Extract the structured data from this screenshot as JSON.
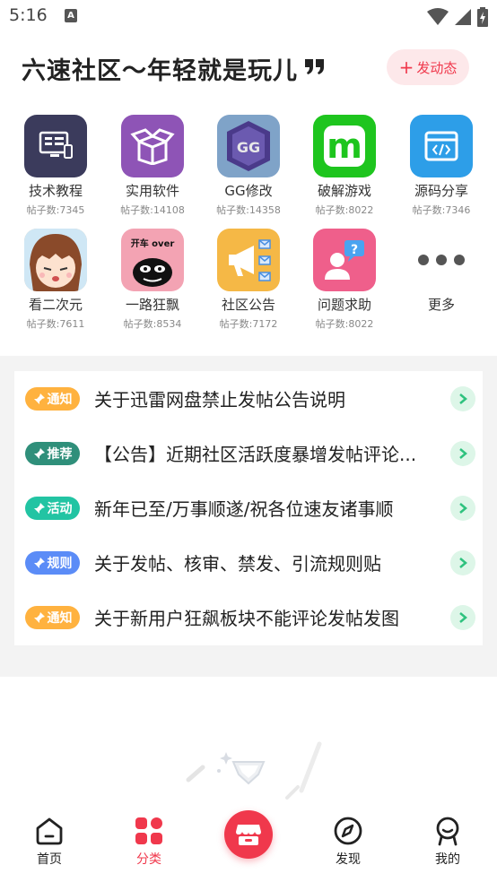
{
  "status_bar": {
    "time": "5:16",
    "notification_letter": "A"
  },
  "header": {
    "title": "六速社区～年轻就是玩儿",
    "post_button": "发动态"
  },
  "categories": [
    {
      "label": "技术教程",
      "count": "帖子数:7345"
    },
    {
      "label": "实用软件",
      "count": "帖子数:14108"
    },
    {
      "label": "GG修改",
      "count": "帖子数:14358",
      "icon_text": "GG"
    },
    {
      "label": "破解游戏",
      "count": "帖子数:8022",
      "icon_text": "m"
    },
    {
      "label": "源码分享",
      "count": "帖子数:7346"
    },
    {
      "label": "看二次元",
      "count": "帖子数:7611"
    },
    {
      "label": "一路狂飘",
      "count": "帖子数:8534",
      "icon_text": "开车 over"
    },
    {
      "label": "社区公告",
      "count": "帖子数:7172"
    },
    {
      "label": "问题求助",
      "count": "帖子数:8022",
      "icon_text": "?"
    },
    {
      "label": "更多"
    }
  ],
  "notices": [
    {
      "tag": "通知",
      "tag_color": "#ffb23f",
      "text": "关于迅雷网盘禁止发帖公告说明"
    },
    {
      "tag": "推荐",
      "tag_color": "#2f8f7a",
      "text": "【公告】近期社区活跃度暴增发帖评论..."
    },
    {
      "tag": "活动",
      "tag_color": "#22c4a3",
      "text": "新年已至/万事顺遂/祝各位速友诸事顺"
    },
    {
      "tag": "规则",
      "tag_color": "#5b8cf7",
      "text": "关于发帖、核审、禁发、引流规则贴"
    },
    {
      "tag": "通知",
      "tag_color": "#ffb23f",
      "text": "关于新用户狂飙板块不能评论发帖发图"
    }
  ],
  "bottom_nav": [
    {
      "label": "首页"
    },
    {
      "label": "分类",
      "active": true
    },
    {
      "label": "发现"
    },
    {
      "label": "我的"
    }
  ],
  "colors": {
    "accent": "#f0384c",
    "arrow_bg": "#ddf6e8",
    "arrow": "#2ec27e"
  }
}
